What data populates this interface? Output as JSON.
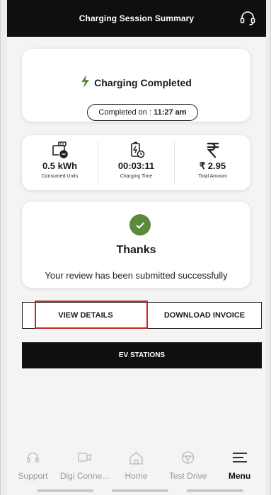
{
  "header": {
    "title": "Charging Session Summary",
    "support_icon": "headset-icon"
  },
  "status_card": {
    "title": "Charging Completed",
    "completed_prefix": "Completed on : ",
    "completed_time": "11:27 am"
  },
  "metrics": [
    {
      "icon": "plug-icon",
      "value": "0.5 kWh",
      "label": "Consumed Units"
    },
    {
      "icon": "charging-timer-icon",
      "value": "00:03:11",
      "label": "Charging Time"
    },
    {
      "icon": "rupee-icon",
      "value": "₹ 2.95",
      "label": "Total Amount"
    }
  ],
  "review_card": {
    "title": "Thanks",
    "message": "Your review has been submitted successfully",
    "accent": "#5b8a3a"
  },
  "actions": {
    "view_details": "VIEW DETAILS",
    "download_invoice": "DOWNLOAD INVOICE",
    "ev_stations": "EV STATIONS"
  },
  "nav": [
    {
      "icon": "support-icon",
      "label": "Support"
    },
    {
      "icon": "digi-connect-icon",
      "label": "Digi Conne..."
    },
    {
      "icon": "home-icon",
      "label": "Home"
    },
    {
      "icon": "test-drive-icon",
      "label": "Test Drive"
    },
    {
      "icon": "menu-icon",
      "label": "Menu",
      "active": true
    }
  ]
}
